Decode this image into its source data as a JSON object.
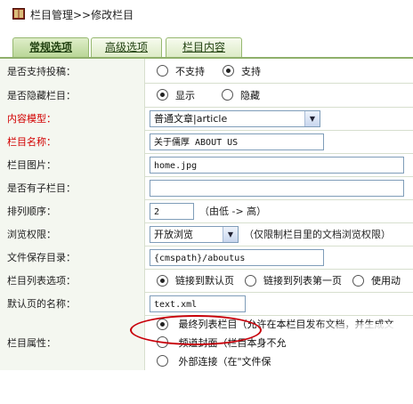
{
  "header": {
    "title": "栏目管理>>修改栏目"
  },
  "tabs": [
    {
      "label": "常规选项",
      "active": true
    },
    {
      "label": "高级选项",
      "active": false
    },
    {
      "label": "栏目内容",
      "active": false
    }
  ],
  "form": {
    "submit": {
      "label": "是否支持投稿：",
      "options": [
        "不支持",
        "支持"
      ],
      "selected": "支持"
    },
    "hidden": {
      "label": "是否隐藏栏目：",
      "options": [
        "显示",
        "隐藏"
      ],
      "selected": "显示"
    },
    "model": {
      "label": "内容模型：",
      "value": "普通文章|article"
    },
    "name": {
      "label": "栏目名称：",
      "value": "关于儒厚 ABOUT US"
    },
    "image": {
      "label": "栏目图片：",
      "value": "home.jpg"
    },
    "subcat": {
      "label": "是否有子栏目：",
      "value": ""
    },
    "order": {
      "label": "排列顺序：",
      "value": "2",
      "hint": "（由低 -> 高）"
    },
    "perm": {
      "label": "浏览权限：",
      "value": "开放浏览",
      "hint": "（仅限制栏目里的文档浏览权限）"
    },
    "dir": {
      "label": "文件保存目录：",
      "value": "{cmspath}/aboutus"
    },
    "list": {
      "label": "栏目列表选项：",
      "options": [
        "链接到默认页",
        "链接到列表第一页",
        "使用动"
      ],
      "selected": "链接到默认页"
    },
    "default": {
      "label": "默认页的名称：",
      "value": "text.xml"
    },
    "attr": {
      "label": "栏目属性：",
      "options": [
        "最终列表栏目（允许在本栏目发布文档，并生成文",
        "频道封面（栏目本身不允",
        "外部连接（在\"文件保"
      ],
      "selected": "最终列表栏目（允许在本栏目发布文档，并生成文"
    }
  },
  "colors": {
    "tab_border": "#96b870",
    "label_red": "#d20000",
    "annotation": "#c8000a"
  },
  "icons": {
    "header": "book-icon"
  }
}
